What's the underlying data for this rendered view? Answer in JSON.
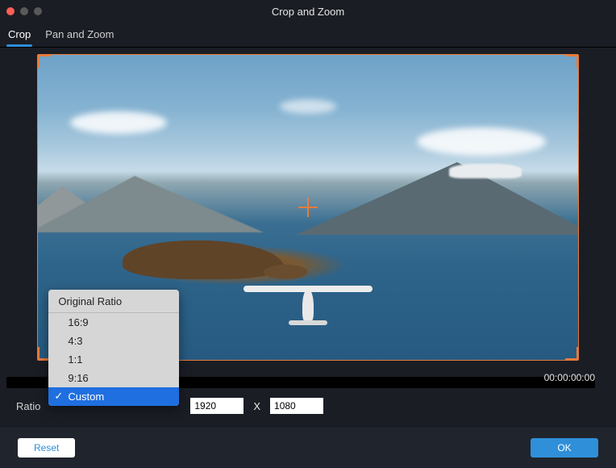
{
  "window": {
    "title": "Crop and Zoom"
  },
  "tabs": {
    "crop": "Crop",
    "pan_zoom": "Pan and Zoom",
    "active": "crop"
  },
  "timecode": "00:00:00:00",
  "ratio": {
    "label": "Ratio",
    "header": "Original Ratio",
    "options": [
      "16:9",
      "4:3",
      "1:1",
      "9:16",
      "Custom"
    ],
    "selected": "Custom"
  },
  "dimensions": {
    "width": "1920",
    "separator": "X",
    "height": "1080"
  },
  "buttons": {
    "reset": "Reset",
    "ok": "OK"
  },
  "colors": {
    "accent": "#2f8fd9",
    "crop_frame": "#e87b3a"
  }
}
